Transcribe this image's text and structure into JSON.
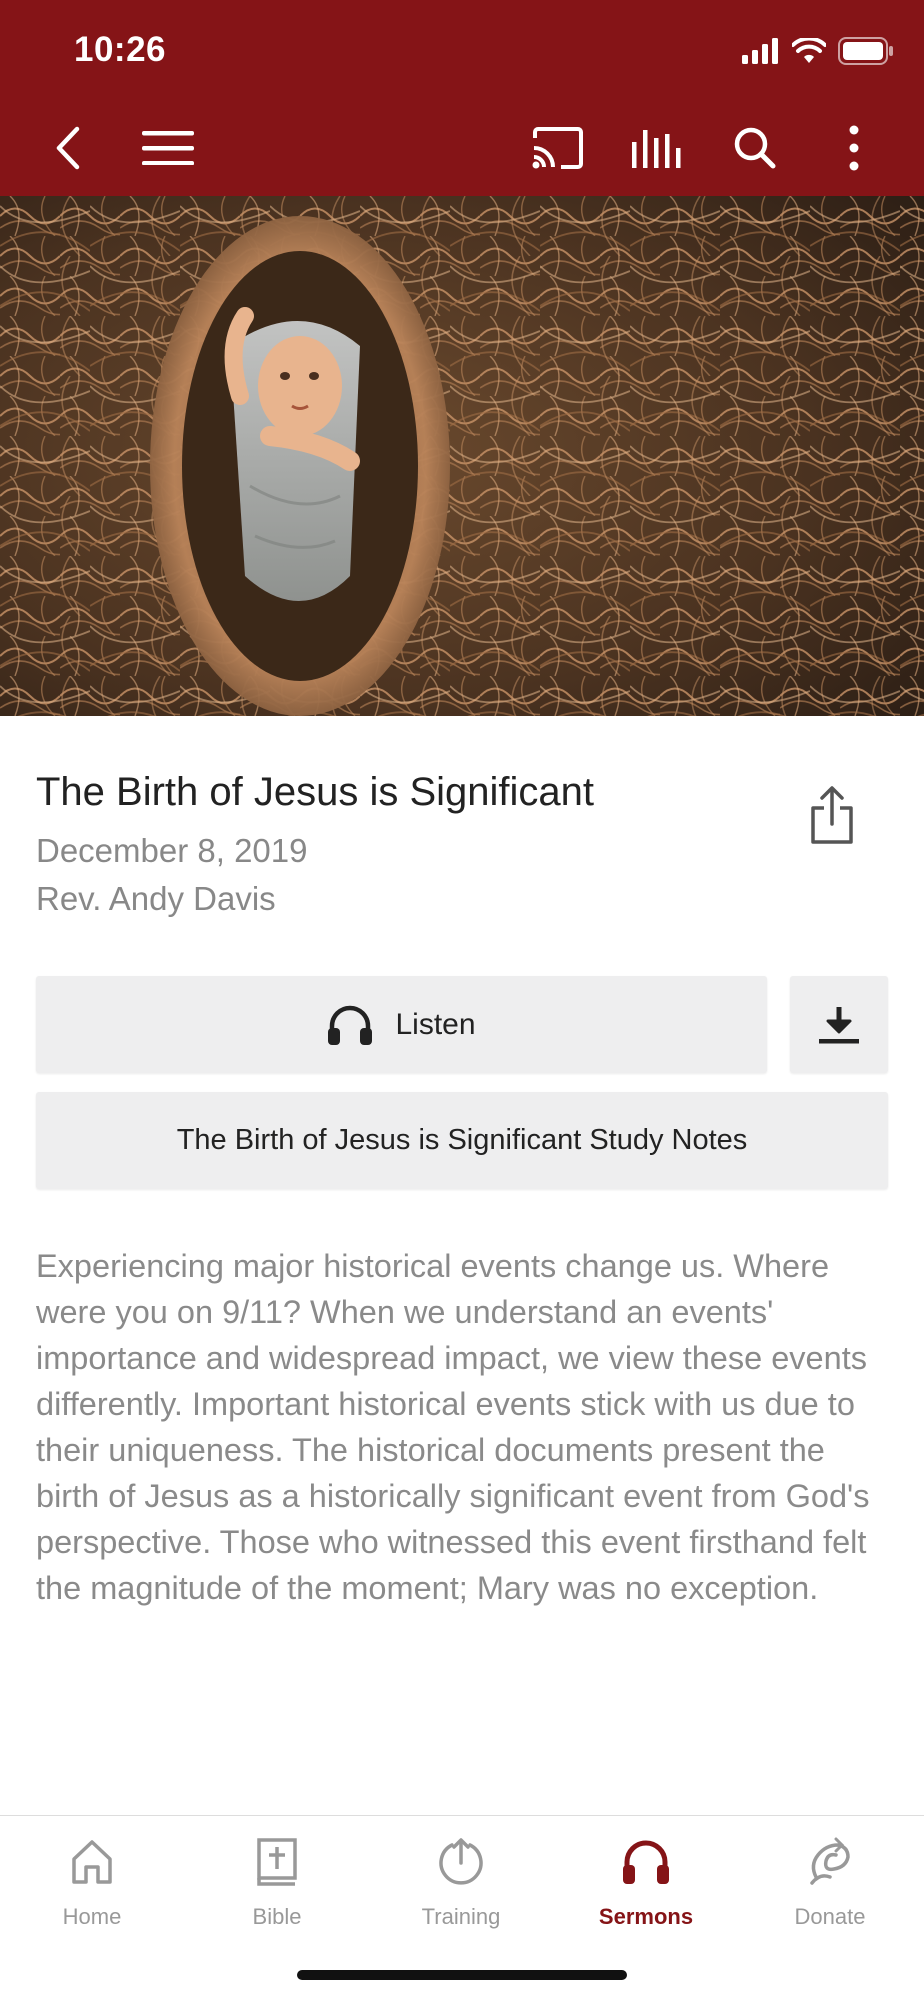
{
  "status_bar": {
    "time": "10:26"
  },
  "toolbar": {
    "icons": [
      "back-icon",
      "menu-icon",
      "cast-icon",
      "equalizer-icon",
      "search-icon",
      "more-vertical-icon"
    ]
  },
  "hero": {
    "icon": "nativity-image"
  },
  "sermon": {
    "title": "The Birth of Jesus is Significant",
    "date": "December 8, 2019",
    "author": "Rev. Andy Davis"
  },
  "actions": {
    "listen_label": "Listen",
    "notes_label": "The Birth of Jesus is Significant Study Notes"
  },
  "description": "Experiencing major historical events change us. Where were you on 9/11? When we understand an events' importance and widespread impact, we view these events differently. Important historical events stick with us due to their uniqueness. The historical documents present the birth of Jesus as a historically significant event from God's perspective. Those who witnessed this event firsthand felt the magnitude of the moment; Mary was no exception.",
  "bottom_nav": {
    "items": [
      {
        "label": "Home",
        "icon": "home-icon",
        "active": false
      },
      {
        "label": "Bible",
        "icon": "bible-icon",
        "active": false
      },
      {
        "label": "Training",
        "icon": "training-icon",
        "active": false
      },
      {
        "label": "Sermons",
        "icon": "headphones-icon",
        "active": true
      },
      {
        "label": "Donate",
        "icon": "donate-icon",
        "active": false
      }
    ]
  },
  "colors": {
    "brand": "#851417",
    "inactive_nav": "#999999",
    "button_bg": "#eeeeef",
    "muted_text": "#8a8a8a"
  }
}
